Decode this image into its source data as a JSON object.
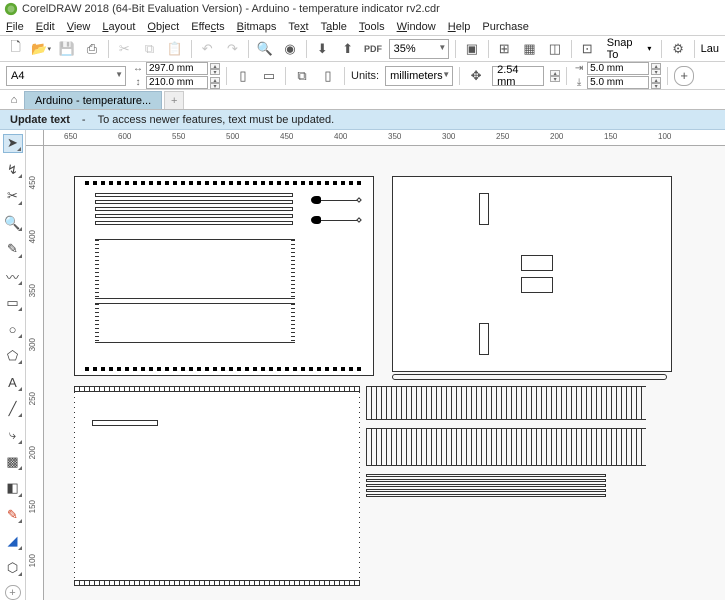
{
  "title": "CorelDRAW 2018 (64-Bit Evaluation Version) - Arduino - temperature indicator rv2.cdr",
  "menu": [
    "File",
    "Edit",
    "View",
    "Layout",
    "Object",
    "Effects",
    "Bitmaps",
    "Text",
    "Table",
    "Tools",
    "Window",
    "Help",
    "Purchase"
  ],
  "toolbar": {
    "zoom": "35%",
    "snapto_label": "Snap To",
    "launch": "Lau"
  },
  "propbar": {
    "page_preset": "A4",
    "width": "297.0 mm",
    "height": "210.0 mm",
    "units_label": "Units:",
    "units_value": "millimeters",
    "nudge": "2.54 mm",
    "dup_x": "5.0 mm",
    "dup_y": "5.0 mm"
  },
  "doctab": "Arduino - temperature...",
  "hint": {
    "title": "Update text",
    "dash": "-",
    "body": "To access newer features, text must be updated."
  },
  "hruler_ticks": [
    "650",
    "600",
    "550",
    "500",
    "450",
    "400",
    "350",
    "300",
    "250",
    "200",
    "150",
    "100"
  ],
  "vruler_ticks": [
    "450",
    "400",
    "350",
    "300",
    "250",
    "200",
    "150",
    "100"
  ]
}
